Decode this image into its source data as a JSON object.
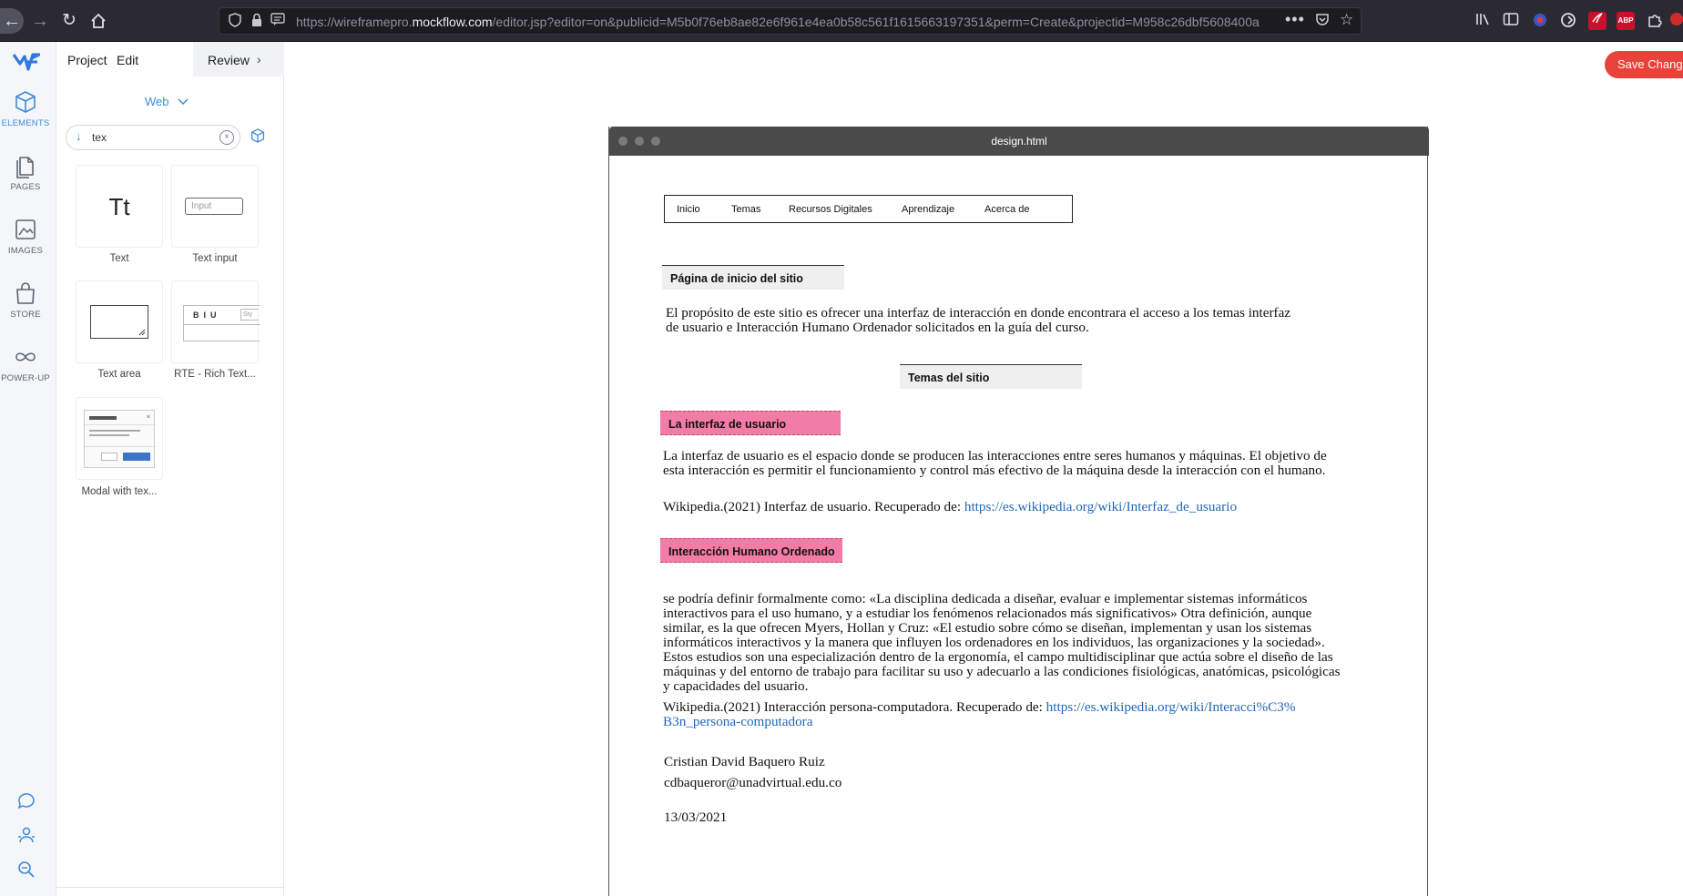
{
  "browser": {
    "url_prefix": "https://wireframepro.",
    "url_domain": "mockflow.com",
    "url_suffix": "/editor.jsp?editor=on&publicid=M5b0f76eb8ae82e6f961e4ea0b58c561f1615663197351&perm=Create&projectid=M958c26dbf5608400a"
  },
  "rail": {
    "items": [
      {
        "label": "ELEMENTS"
      },
      {
        "label": "PAGES"
      },
      {
        "label": "IMAGES"
      },
      {
        "label": "STORE"
      },
      {
        "label": "POWER-UP"
      }
    ],
    "accent": "#3d8bd8"
  },
  "panel": {
    "menu_project": "Project",
    "menu_edit": "Edit",
    "menu_review": "Review",
    "platform": "Web",
    "search_value": "tex",
    "tiles": [
      {
        "label": "Text",
        "glyph": "Tt"
      },
      {
        "label": "Text input",
        "glyph": "Input"
      },
      {
        "label": "Text area"
      },
      {
        "label": "RTE - Rich Text...",
        "glyph": "B  I  U"
      },
      {
        "label": "Modal with tex..."
      }
    ]
  },
  "toolbar": {
    "save_label": "Save Changes",
    "save_color": "#e9423a"
  },
  "canvas": {
    "title": "design.html",
    "nav": [
      "Inicio",
      "Temas",
      "Recursos Digitales",
      "Aprendizaje",
      "Acerca de"
    ],
    "home_heading": "Página de inicio del sitio",
    "home_intro": "El propósito de este sitio es ofrecer una interfaz de interacción en donde encontrara el acceso a los temas interfaz de usuario e Interacción Humano Ordenador solicitados en la guía del curso.",
    "topics_heading": "Temas del sitio",
    "section1": {
      "heading": "La interfaz de usuario",
      "body": "La interfaz de usuario es el espacio donde se producen las interacciones entre seres humanos y máquinas. El objetivo de esta interacción es permitir el funcionamiento y control más efectivo de la máquina desde la interacción con el humano.",
      "citation": "Wikipedia.(2021) Interfaz de usuario. Recuperado de: ",
      "link": "https://es.wikipedia.org/wiki/Interfaz_de_usuario"
    },
    "section2": {
      "heading": "Interacción Humano Ordenado",
      "body": "se podría definir formalmente como: «La disciplina dedicada a diseñar, evaluar e implementar sistemas informáticos interactivos para el uso humano, y a estudiar los fenómenos relacionados más significativos» Otra definición, aunque similar, es la que ofrecen Myers, Hollan y Cruz: «El estudio sobre cómo se diseñan, implementan y usan los sistemas informáticos interactivos y la manera que influyen los ordenadores en los individuos, las organizaciones y la sociedad». Estos estudios son una especialización dentro de la ergonomía, el campo multidisciplinar que actúa sobre el diseño de las máquinas y del entorno de trabajo para facilitar su uso y adecuarlo a las condiciones fisiológicas, anatómicas, psicológicas y capacidades del usuario.",
      "citation": "Wikipedia.(2021) Interacción persona-computadora. Recuperado de: ",
      "link": "https://es.wikipedia.org/wiki/Interacci%C3%B3n_persona-computadora"
    },
    "author": "Cristian David Baquero Ruiz",
    "email": "cdbaqueror@unadvirtual.edu.co",
    "date": "13/03/2021",
    "pink_header_color": "#f27ca5",
    "link_color": "#2367b7"
  }
}
